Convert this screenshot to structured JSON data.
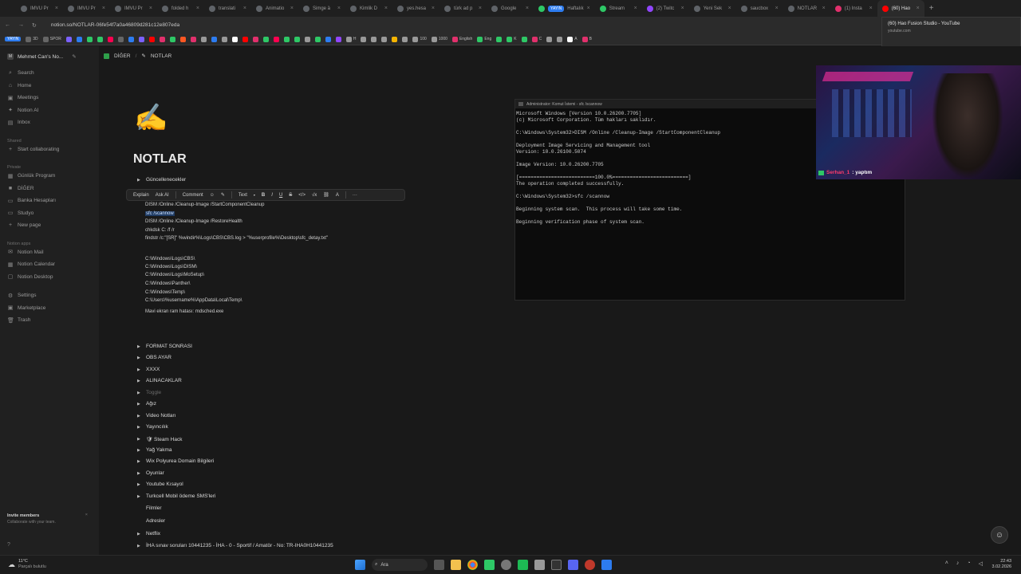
{
  "browser": {
    "tabs": [
      {
        "label": "IMVU Pr",
        "color": "#5f6368"
      },
      {
        "label": "IMVU Pr",
        "color": "#5f6368"
      },
      {
        "label": "IMVU Pr",
        "color": "#5f6368"
      },
      {
        "label": "folded h",
        "color": "#5f6368"
      },
      {
        "label": "translati",
        "color": "#5f6368"
      },
      {
        "label": "Animatio",
        "color": "#5f6368"
      },
      {
        "label": "Simge ä",
        "color": "#5f6368"
      },
      {
        "label": "Kimlik D",
        "color": "#5f6368"
      },
      {
        "label": "yes.hesa",
        "color": "#5f6368"
      },
      {
        "label": "türk ad p",
        "color": "#5f6368"
      },
      {
        "label": "Google",
        "color": "#5f6368"
      },
      {
        "label": "Haftalık",
        "color": "#2ec866",
        "pill": "YAYIN"
      },
      {
        "label": "Stream",
        "color": "#2ec866"
      },
      {
        "label": "(2) Twitc",
        "color": "#9146ff"
      },
      {
        "label": "Yeni Sek",
        "color": "#5f6368"
      },
      {
        "label": "saucbox",
        "color": "#5f6368"
      },
      {
        "label": "NOTLAR",
        "color": "#5f6368"
      },
      {
        "label": "(1) Insta",
        "color": "#e1306c"
      },
      {
        "label": "(60) Hao",
        "color": "#ff0000",
        "active": true
      }
    ],
    "new_tab": "+",
    "url": "notion.so/NOTLAR-06fe54f7a0a46809d281c12e807eda",
    "bookmarks": [
      {
        "label": "YAYIN",
        "color": "#2d7cf0",
        "pill": true
      },
      {
        "label": "3D",
        "color": "#666"
      },
      {
        "label": "SPOR",
        "color": "#666"
      },
      {
        "label": "",
        "color": "#7b61ff"
      },
      {
        "label": "",
        "color": "#2d7cf0"
      },
      {
        "label": "",
        "color": "#2ec866"
      },
      {
        "label": "",
        "color": "#2ec866"
      },
      {
        "label": "",
        "color": "#ff0050"
      },
      {
        "label": "",
        "color": "#666"
      },
      {
        "label": "",
        "color": "#2d7cf0"
      },
      {
        "label": "",
        "color": "#7b61ff"
      },
      {
        "label": "",
        "color": "#ff0000"
      },
      {
        "label": "",
        "color": "#e1306c"
      },
      {
        "label": "",
        "color": "#2ec866"
      },
      {
        "label": "",
        "color": "#ff5722"
      },
      {
        "label": "",
        "color": "#e1306c"
      },
      {
        "label": "",
        "color": "#999"
      },
      {
        "label": "",
        "color": "#2d7cf0"
      },
      {
        "label": "",
        "color": "#999"
      },
      {
        "label": "",
        "color": "#fff"
      },
      {
        "label": "",
        "color": "#ff0000"
      },
      {
        "label": "",
        "color": "#e1306c"
      },
      {
        "label": "",
        "color": "#2ec866"
      },
      {
        "label": "",
        "color": "#ff0050"
      },
      {
        "label": "",
        "color": "#2ec866"
      },
      {
        "label": "",
        "color": "#2ec866"
      },
      {
        "label": "",
        "color": "#999"
      },
      {
        "label": "",
        "color": "#2ec866"
      },
      {
        "label": "",
        "color": "#2d7cf0"
      },
      {
        "label": "",
        "color": "#9146ff"
      },
      {
        "label": "H",
        "color": "#999"
      },
      {
        "label": "",
        "color": "#999"
      },
      {
        "label": "",
        "color": "#999"
      },
      {
        "label": "",
        "color": "#999"
      },
      {
        "label": "",
        "color": "#f4b400"
      },
      {
        "label": "",
        "color": "#999"
      },
      {
        "label": "100",
        "color": "#999"
      },
      {
        "label": "1000",
        "color": "#999"
      },
      {
        "label": "English",
        "color": "#e1306c"
      },
      {
        "label": "Eng",
        "color": "#2ec866"
      },
      {
        "label": "",
        "color": "#2ec866"
      },
      {
        "label": "K",
        "color": "#2ec866"
      },
      {
        "label": "",
        "color": "#2ec866"
      },
      {
        "label": "C",
        "color": "#e1306c"
      },
      {
        "label": "",
        "color": "#999"
      },
      {
        "label": "",
        "color": "#999"
      },
      {
        "label": "A",
        "color": "#fff"
      },
      {
        "label": "B",
        "color": "#e1306c"
      }
    ],
    "tooltip": {
      "title": "(60) Hao Fusion Studio - YouTube",
      "domain": "youtube.com"
    }
  },
  "sidebar": {
    "workspace": "Mehmet Can's No...",
    "nav": [
      {
        "icon": "⌕",
        "label": "Search",
        "name": "search"
      },
      {
        "icon": "⌂",
        "label": "Home",
        "name": "home"
      },
      {
        "icon": "▣",
        "label": "Meetings",
        "name": "meetings"
      },
      {
        "icon": "✦",
        "label": "Notion AI",
        "name": "notion-ai"
      },
      {
        "icon": "▤",
        "label": "Inbox",
        "name": "inbox"
      }
    ],
    "shared_heading": "Shared",
    "shared": [
      {
        "icon": "+",
        "label": "Start collaborating",
        "name": "start-collaborating"
      }
    ],
    "private_heading": "Private",
    "private": [
      {
        "icon": "▦",
        "label": "Günlük Program",
        "name": "gunluk-program"
      },
      {
        "icon": "■",
        "label": "DİĞER",
        "name": "diger"
      },
      {
        "icon": "▭",
        "label": "Banka Hesapları",
        "name": "banka-hesaplari"
      },
      {
        "icon": "▭",
        "label": "Studyo",
        "name": "studyo"
      },
      {
        "icon": "+",
        "label": "New page",
        "name": "new-page"
      }
    ],
    "apps_heading": "Notion apps",
    "apps": [
      {
        "icon": "✉",
        "label": "Notion Mail",
        "name": "notion-mail"
      },
      {
        "icon": "▦",
        "label": "Notion Calendar",
        "name": "notion-calendar"
      },
      {
        "icon": "▢",
        "label": "Notion Desktop",
        "name": "notion-desktop"
      }
    ],
    "bottom": [
      {
        "icon": "⚙",
        "label": "Settings",
        "name": "settings"
      },
      {
        "icon": "▣",
        "label": "Marketplace",
        "name": "marketplace"
      },
      {
        "icon": "🗑",
        "label": "Trash",
        "name": "trash"
      }
    ],
    "invite_title": "Invite members",
    "invite_sub": "Collaborate with your team.",
    "help": "?"
  },
  "page": {
    "breadcrumb": [
      "DİĞER",
      "NOTLAR"
    ],
    "icon": "✍",
    "title": "NOTLAR",
    "toggle_first": "Güncellenecekler",
    "toolbar": {
      "explain": "Explain",
      "ask_ai": "Ask AI",
      "comment": "Comment",
      "text": "Text",
      "bold": "B",
      "italic": "I",
      "underline": "U",
      "strike": "S",
      "code": "</>",
      "math": "√x",
      "link": "⛓",
      "color": "A",
      "more": "···"
    },
    "code_lines": [
      "DISM /Online /Cleanup-Image /StartComponentCleanup",
      "sfc /scannow",
      "DISM /Online /Cleanup-Image /RestoreHealth",
      "chkdsk C: /f /r",
      "findstr /c:\"[SR]\" %windir%\\Logs\\CBS\\CBS.log > \"%userprofile%\\Desktop\\sfc_detay.txt\"",
      "",
      "C:\\Windows\\Logs\\CBS\\",
      "C:\\Windows\\Logs\\DISM\\",
      "C:\\Windows\\Logs\\MoSetup\\",
      "C:\\Windows\\Panther\\",
      "C:\\Windows\\Temp\\",
      "C:\\Users\\%username%\\AppData\\Local\\Temp\\",
      "",
      "Mavi ekran ram hatası: mdsched.exe"
    ],
    "toggles": [
      "FORMAT SONRASI",
      "OBS AYAR",
      "XXXX",
      "ALINACAKLAR",
      "Toggle",
      "Ağız",
      "Video Notları",
      "Yayıncılık",
      "🛡 Steam Hack",
      "Yağ Yakma",
      "Wix Polyurea Domain Bilgileri",
      "Oyunlar",
      "Youtube Kısayol",
      "Turkcell Mobil ödeme SMS'leri",
      "Filmler",
      "Adresler",
      "Netflix",
      "İHA sınav soruları 10441235 - İHA - 0 - Sportif / Amatör - No: TR-IHA0H10441235"
    ]
  },
  "terminal": {
    "title": "Administrator: Komut İstemi - sfc /scannow",
    "text": "Microsoft Windows [Version 10.0.26200.7705]\n(c) Microsoft Corporation. Tüm hakları saklıdır.\n\nC:\\Windows\\System32>DISM /Online /Cleanup-Image /StartComponentCleanup\n\nDeployment Image Servicing and Management tool\nVersion: 10.0.26100.5074\n\nImage Version: 10.0.26200.7705\n\n[==========================100.0%==========================]\nThe operation completed successfully.\n\nC:\\Windows\\System32>sfc /scannow\n\nBeginning system scan.  This process will take some time.\n\nBeginning verification phase of system scan."
  },
  "webcam": {
    "chat_user": "Serhan_1",
    "chat_text": ": yaptım"
  },
  "taskbar": {
    "temp": "11°C",
    "weather": "Parçalı bulutlu",
    "search": "Ara",
    "time": "22:43",
    "date": "3.02.2026"
  }
}
